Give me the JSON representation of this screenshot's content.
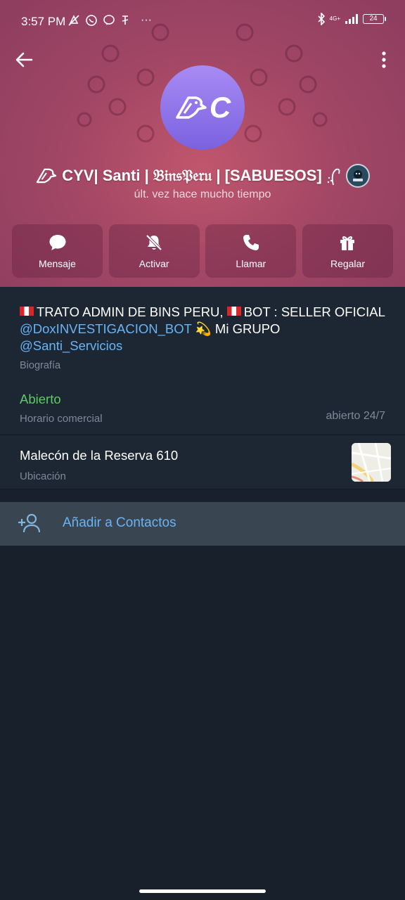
{
  "status_bar": {
    "time": "3:57 PM",
    "network": "4G+",
    "battery": "24",
    "more_indicator": "···"
  },
  "header": {
    "avatar_letter": "C",
    "name": "CYV| Santi | 𝔅𝔦𝔫𝔰𝔓𝔢𝔯𝔲 | [SABUESOS]",
    "last_seen": "últ. vez hace mucho tiempo",
    "accent": "#a34766"
  },
  "actions": [
    {
      "label": "Mensaje",
      "icon": "chat-bubble-icon"
    },
    {
      "label": "Activar",
      "icon": "bell-off-icon"
    },
    {
      "label": "Llamar",
      "icon": "phone-icon"
    },
    {
      "label": "Regalar",
      "icon": "gift-icon"
    }
  ],
  "bio": {
    "part1": "TRATO ADMIN DE BINS PERU, ",
    "part2": "BOT : SELLER OFICIAL ",
    "bot_link": "@DoxINVESTIGACION_BOT",
    "part3": " 💫 Mi GRUPO ",
    "group_link": "@Santi_Servicios",
    "label": "Biografía"
  },
  "business_hours": {
    "status": "Abierto",
    "label": "Horario comercial",
    "value": "abierto 24/7",
    "status_color": "#5fca63"
  },
  "location": {
    "address": "Malecón de la Reserva 610",
    "label": "Ubicación"
  },
  "add_contact": {
    "label": "Añadir a Contactos",
    "link_color": "#6ab3f3"
  }
}
